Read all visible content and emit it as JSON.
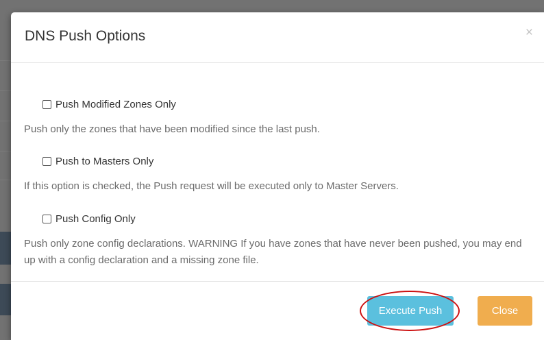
{
  "modal": {
    "title": "DNS Push Options",
    "close_glyph": "×"
  },
  "options": [
    {
      "label": "Push Modified Zones Only",
      "description": "Push only the zones that have been modified since the last push.",
      "checked": false
    },
    {
      "label": "Push to Masters Only",
      "description": "If this option is checked, the Push request will be executed only to Master Servers.",
      "checked": false
    },
    {
      "label": "Push Config Only",
      "description": "Push only zone config declarations. WARNING If you have zones that have never been pushed, you may end up with a config declaration and a missing zone file.",
      "checked": false
    }
  ],
  "footer": {
    "execute_label": "Execute Push",
    "close_label": "Close"
  },
  "colors": {
    "execute_button": "#5bc0de",
    "close_button": "#f0ad4e",
    "highlight_ring": "#cc1010"
  },
  "icons": {
    "close": "close-icon",
    "checkbox": "checkbox-unchecked-icon"
  }
}
